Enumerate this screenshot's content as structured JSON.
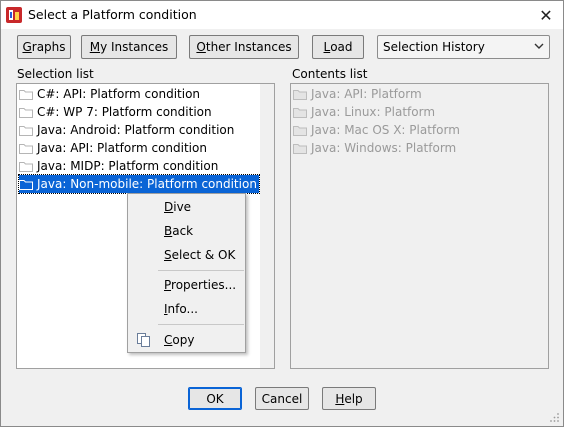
{
  "window": {
    "title": "Select a Platform condition",
    "close_glyph": "✕",
    "icon": "app-logo-icon"
  },
  "toolbar": {
    "graphs": {
      "pre": "",
      "ul": "G",
      "post": "raphs"
    },
    "my_instances": {
      "pre": "",
      "ul": "M",
      "post": "y Instances"
    },
    "other_instances": {
      "pre": "",
      "ul": "O",
      "post": "ther Instances"
    },
    "load": {
      "pre": "",
      "ul": "L",
      "post": "oad"
    },
    "history_select": {
      "value": "Selection History",
      "chevron": "⌄"
    }
  },
  "selection_list": {
    "label": "Selection list",
    "items": [
      {
        "label": "C#: API: Platform condition"
      },
      {
        "label": "C#: WP 7: Platform condition"
      },
      {
        "label": "Java: Android: Platform condition"
      },
      {
        "label": "Java: API: Platform condition"
      },
      {
        "label": "Java: MIDP: Platform condition"
      },
      {
        "label": "Java: Non-mobile: Platform condition",
        "selected": true
      }
    ]
  },
  "contents_list": {
    "label": "Contents list",
    "items": [
      {
        "label": "Java: API: Platform"
      },
      {
        "label": "Java: Linux: Platform"
      },
      {
        "label": "Java: Mac OS X: Platform"
      },
      {
        "label": "Java: Windows: Platform"
      }
    ]
  },
  "context_menu": {
    "dive": {
      "pre": "",
      "ul": "D",
      "post": "ive"
    },
    "back": {
      "pre": "",
      "ul": "B",
      "post": "ack"
    },
    "select_ok": {
      "pre": "",
      "ul": "S",
      "post": "elect & OK"
    },
    "properties": {
      "pre": "",
      "ul": "P",
      "post": "roperties..."
    },
    "info": {
      "pre": "",
      "ul": "I",
      "post": "nfo..."
    },
    "copy": {
      "pre": "",
      "ul": "C",
      "post": "opy"
    }
  },
  "footer": {
    "ok": "OK",
    "cancel": "Cancel",
    "help": {
      "pre": "",
      "ul": "H",
      "post": "elp"
    }
  },
  "colors": {
    "selection": "#0a64d6",
    "disabled_text": "#9a9a9a",
    "folder": "#d8d8d8"
  }
}
